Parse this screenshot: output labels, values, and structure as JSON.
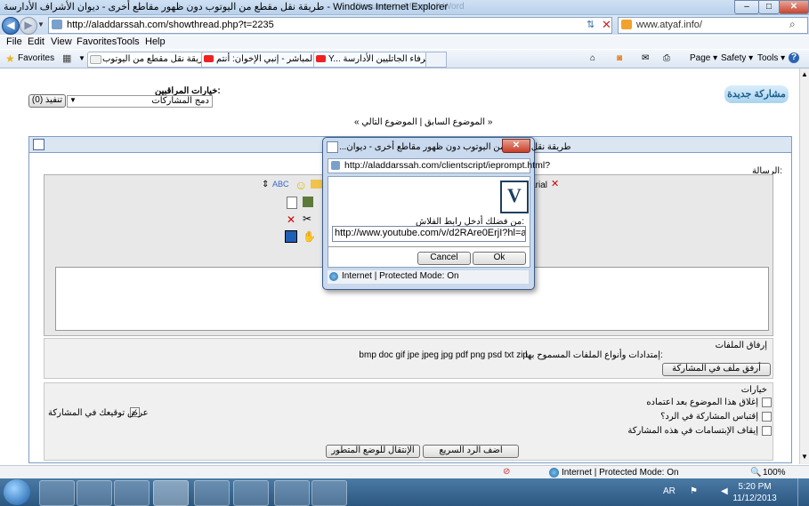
{
  "window": {
    "title": "طريقة نقل مقطع من اليوتوب دون ظهور مقاطع أخرى - ديوان الأشراف الأدارسة - Windows Internet Explorer",
    "ghost_text": "Document - Microsoft Word",
    "minimize": "–",
    "maximize": "□",
    "close": "✕"
  },
  "addressbar": {
    "url": "http://aladdarssah.com/showthread.php?t=2235",
    "search_value": "www.atyaf.info/"
  },
  "menu": {
    "file": "File",
    "edit": "Edit",
    "view": "View",
    "favorites": "Favorites",
    "tools": "Tools",
    "help": "Help"
  },
  "favbar": {
    "favorites_label": "Favorites",
    "tabs": [
      {
        "label": "طريقة نقل مقطع من اليوتوب"
      },
      {
        "label": "البث المباشر - إنبي الإخوان: أنتم"
      },
      {
        "label": "Y... الشرفاء الجاتليين الأدارسة"
      }
    ],
    "tab_close": "✕",
    "page_menu": "Page ▾",
    "safety_menu": "Safety ▾",
    "tools_menu": "Tools ▾",
    "help_icon": "?"
  },
  "forum": {
    "moderator_options": "خيارات المراقبين:",
    "merge_posts": "دمج المشاركات",
    "execute_button": "(0) تنفيذ",
    "prev_next": "« الموضوع السابق | الموضوع التالي »",
    "logo": "مشاركة جديدة",
    "message_label": "الرسالة:",
    "font_name": "Arial",
    "attachments_title": "إرفاق الملفات",
    "allowed_types_label": "إمتدادات وأنواع الملفات المسموح بها:",
    "allowed_types": "bmp doc gif jpe jpeg jpg pdf png psd txt zip",
    "attach_button": "أرفق ملف في المشاركة",
    "options_title": "خيارات",
    "close_after_approval": "إغلاق هذا الموضوع بعد اعتماده",
    "quote_in_reply": "إقتباس المشاركة في الرد؟",
    "disable_smilies": "إيقاف الإبتسامات في هذه المشاركة",
    "show_signature": "عرض توقيعك في المشاركة",
    "quick_reply_button": "اضف الرد السريع",
    "advanced_button": "الإنتقال للوضع المتطور"
  },
  "dialog": {
    "title": "...طريقة نقل مقطع من اليوتوب دون ظهور مقاطع أخرى - ديوان",
    "url": "http://aladdarssah.com/clientscript/ieprompt.html?",
    "prompt_label": "من فضلك أدخل رابط الفلاش:",
    "input_value": "http://www.youtube.com/v/d2RAre0ErjI?hl=a",
    "cancel": "Cancel",
    "ok": "Ok",
    "status": "Internet | Protected Mode: On"
  },
  "statusbar": {
    "zone": "Internet | Protected Mode: On",
    "zoom": "100%"
  },
  "taskbar": {
    "lang": "AR",
    "time": "5:20 PM",
    "date": "11/12/2013"
  }
}
